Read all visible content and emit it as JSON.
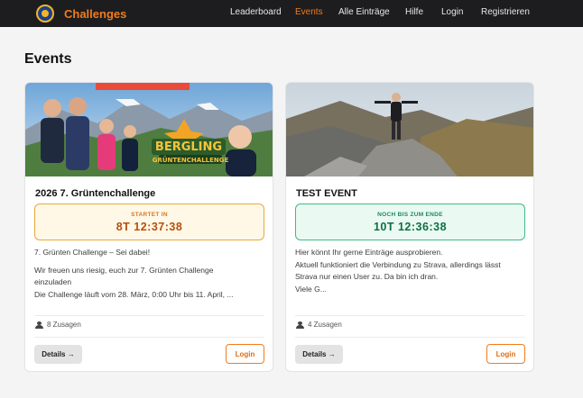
{
  "nav": {
    "brand": "Challenges",
    "links": [
      "Leaderboard",
      "Events",
      "Alle Einträge",
      "Hilfe",
      "Login",
      "Registrieren"
    ],
    "active": "Events"
  },
  "page": {
    "title": "Events"
  },
  "events": [
    {
      "title": "2026 7. Grüntenchallenge",
      "timer_label": "STARTET IN",
      "timer_value": "8T 12:37:38",
      "timer_color": "orange",
      "description": [
        "7. Grünten Challenge – Sei dabei!",
        "",
        "Wir freuen uns riesig, euch zur 7. Grünten Challenge",
        "einzuladen",
        "Die Challenge läuft vom 28. März, 0:00 Uhr bis 11. April, ..."
      ],
      "image_text": [
        "BERGLING",
        "GRÜNTENCHALLENGE"
      ],
      "attendees": "8 Zusagen",
      "details_label": "Details →",
      "login_label": "Login"
    },
    {
      "title": "TEST EVENT",
      "timer_label": "NOCH BIS ZUM ENDE",
      "timer_value": "10T 12:36:38",
      "timer_color": "green",
      "description": [
        "Hier könnt Ihr gerne Einträge ausprobieren.",
        "Aktuell funktioniert die Verbindung zu Strava, allerdings lässt",
        "Strava nur einen User zu. Da bin ich dran.",
        "Viele G..."
      ],
      "attendees": "4 Zusagen",
      "details_label": "Details →",
      "login_label": "Login"
    }
  ],
  "colors": {
    "accent": "#f07c1c",
    "navbar": "#1d1d1f",
    "page_bg": "#f4f4f5"
  }
}
